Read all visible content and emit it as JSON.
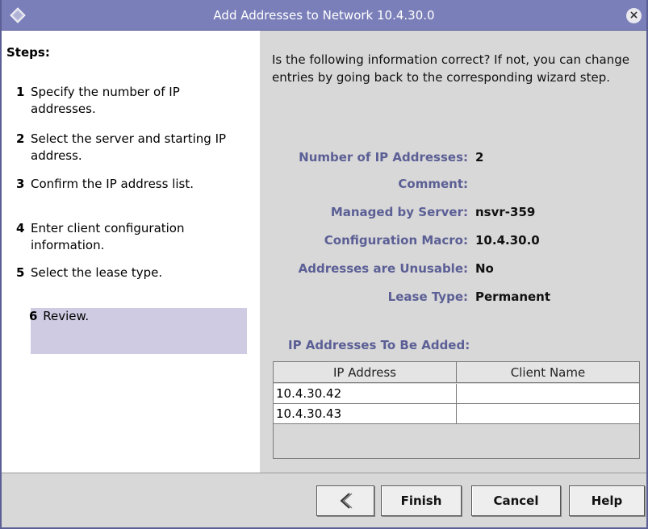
{
  "window": {
    "title": "Add Addresses to Network 10.4.30.0",
    "close_symbol": "×"
  },
  "steps": {
    "heading": "Steps:",
    "items": [
      {
        "num": "1",
        "text": "Specify the number of IP addresses."
      },
      {
        "num": "2",
        "text": "Select the server and starting IP address."
      },
      {
        "num": "3",
        "text": "Confirm the IP address list."
      },
      {
        "num": "4",
        "text": "Enter client configuration information."
      },
      {
        "num": "5",
        "text": "Select the lease type."
      },
      {
        "num": "6",
        "text": "Review.",
        "active": true
      }
    ]
  },
  "review": {
    "intro": "Is the following information correct? If not, you can change entries by going back to the corresponding wizard step.",
    "fields": [
      {
        "label": "Number of IP Addresses:",
        "value": "2"
      },
      {
        "label": "Comment:",
        "value": ""
      },
      {
        "label": "Managed by Server:",
        "value": "nsvr-359"
      },
      {
        "label": "Configuration Macro:",
        "value": "10.4.30.0"
      },
      {
        "label": "Addresses are Unusable:",
        "value": "No"
      },
      {
        "label": "Lease Type:",
        "value": "Permanent"
      }
    ],
    "ip_heading": "IP Addresses To Be Added:",
    "table": {
      "columns": [
        "IP Address",
        "Client Name"
      ],
      "rows": [
        [
          "10.4.30.42",
          ""
        ],
        [
          "10.4.30.43",
          ""
        ]
      ]
    }
  },
  "buttons": {
    "back_icon": "chevron-left-icon",
    "finish": "Finish",
    "cancel": "Cancel",
    "help": "Help"
  },
  "colors": {
    "titlebar": "#7b7fb9",
    "label": "#5b5f95",
    "active_step": "#cfcbe3",
    "panel": "#d8d8d8"
  }
}
